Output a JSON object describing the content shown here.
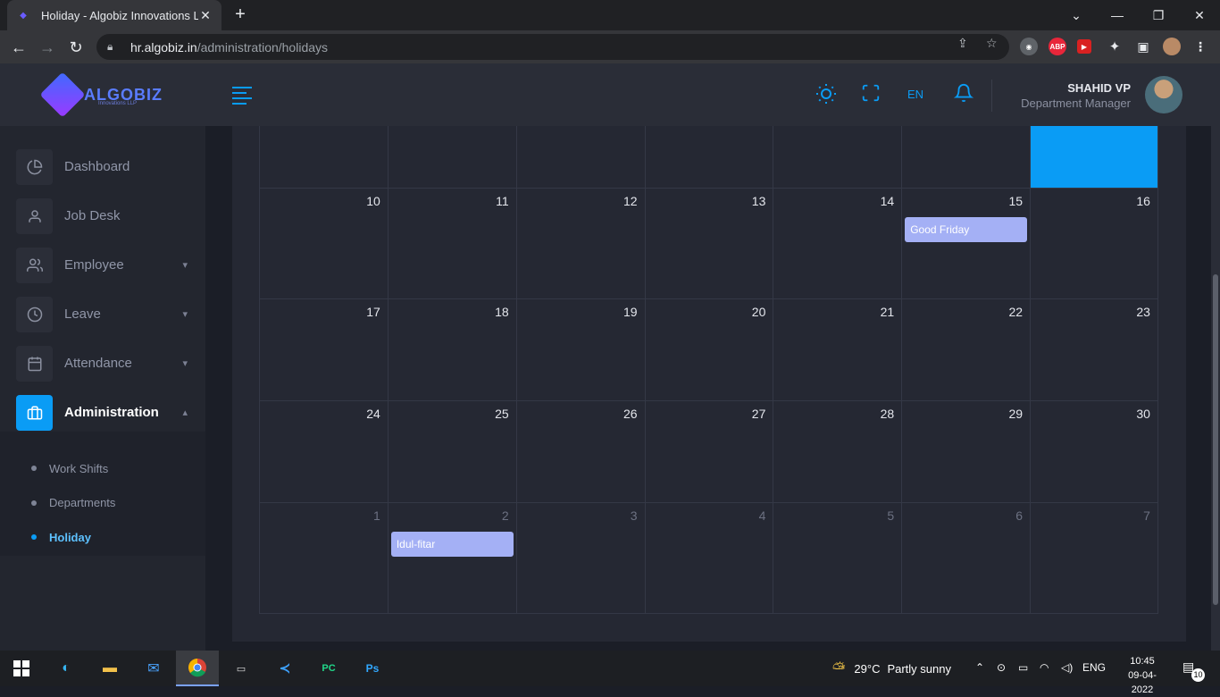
{
  "browser": {
    "tab_title": "Holiday - Algobiz Innovations LLP",
    "tab_close": "✕",
    "new_tab": "+",
    "url_host": "hr.algobiz.in",
    "url_path": "/administration/holidays",
    "extensions": [
      "ABP"
    ]
  },
  "app": {
    "logo_text": "ALGOBIZ",
    "logo_sub": "Innovations LLP",
    "sidebar": {
      "items": [
        {
          "label": "Dashboard",
          "icon": "pie-chart-icon"
        },
        {
          "label": "Job Desk",
          "icon": "user-icon"
        },
        {
          "label": "Employee",
          "icon": "users-icon"
        },
        {
          "label": "Leave",
          "icon": "clock-icon"
        },
        {
          "label": "Attendance",
          "icon": "calendar-icon"
        },
        {
          "label": "Administration",
          "icon": "briefcase-icon"
        }
      ],
      "submenu": [
        {
          "label": "Work Shifts"
        },
        {
          "label": "Departments"
        },
        {
          "label": "Holiday"
        }
      ]
    },
    "header": {
      "lang": "EN",
      "user_name": "SHAHID VP",
      "user_role": "Department Manager"
    }
  },
  "calendar": {
    "weeks": [
      {
        "days": [
          "",
          "",
          "",
          "",
          "",
          "",
          ""
        ]
      },
      {
        "days": [
          "10",
          "11",
          "12",
          "13",
          "14",
          "15",
          "16"
        ]
      },
      {
        "days": [
          "17",
          "18",
          "19",
          "20",
          "21",
          "22",
          "23"
        ]
      },
      {
        "days": [
          "24",
          "25",
          "26",
          "27",
          "28",
          "29",
          "30"
        ]
      },
      {
        "days": [
          "1",
          "2",
          "3",
          "4",
          "5",
          "6",
          "7"
        ]
      }
    ],
    "events": [
      {
        "week": 1,
        "day": 5,
        "title": "Good Friday"
      },
      {
        "week": 4,
        "day": 1,
        "title": "Idul-fitar"
      }
    ]
  },
  "taskbar": {
    "weather_temp": "29°C",
    "weather_text": "Partly sunny",
    "lang": "ENG",
    "time": "10:45",
    "date": "09-04-2022",
    "notifications": "10"
  },
  "colors": {
    "accent": "#0a9cf5",
    "event": "#a4b0f5"
  }
}
